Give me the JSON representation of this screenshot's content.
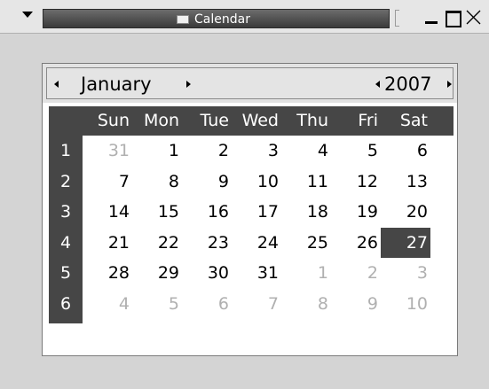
{
  "window": {
    "title": "Calendar"
  },
  "calendar": {
    "month": "January",
    "year": "2007",
    "weekdays": [
      "Sun",
      "Mon",
      "Tue",
      "Wed",
      "Thu",
      "Fri",
      "Sat"
    ],
    "weeks": [
      {
        "num": "1",
        "days": [
          {
            "d": "31",
            "other": true
          },
          {
            "d": "1"
          },
          {
            "d": "2"
          },
          {
            "d": "3"
          },
          {
            "d": "4"
          },
          {
            "d": "5"
          },
          {
            "d": "6"
          }
        ]
      },
      {
        "num": "2",
        "days": [
          {
            "d": "7"
          },
          {
            "d": "8"
          },
          {
            "d": "9"
          },
          {
            "d": "10"
          },
          {
            "d": "11"
          },
          {
            "d": "12"
          },
          {
            "d": "13"
          }
        ]
      },
      {
        "num": "3",
        "days": [
          {
            "d": "14"
          },
          {
            "d": "15"
          },
          {
            "d": "16"
          },
          {
            "d": "17"
          },
          {
            "d": "18"
          },
          {
            "d": "19"
          },
          {
            "d": "20"
          }
        ]
      },
      {
        "num": "4",
        "days": [
          {
            "d": "21"
          },
          {
            "d": "22"
          },
          {
            "d": "23"
          },
          {
            "d": "24"
          },
          {
            "d": "25"
          },
          {
            "d": "26"
          },
          {
            "d": "27",
            "selected": true
          }
        ]
      },
      {
        "num": "5",
        "days": [
          {
            "d": "28"
          },
          {
            "d": "29"
          },
          {
            "d": "30"
          },
          {
            "d": "31"
          },
          {
            "d": "1",
            "other": true
          },
          {
            "d": "2",
            "other": true
          },
          {
            "d": "3",
            "other": true
          }
        ]
      },
      {
        "num": "6",
        "days": [
          {
            "d": "4",
            "other": true
          },
          {
            "d": "5",
            "other": true
          },
          {
            "d": "6",
            "other": true
          },
          {
            "d": "7",
            "other": true
          },
          {
            "d": "8",
            "other": true
          },
          {
            "d": "9",
            "other": true
          },
          {
            "d": "10",
            "other": true
          }
        ]
      }
    ]
  },
  "colors": {
    "header_dark": "#464646",
    "selected_bg": "#464646",
    "other_month_text": "#b0b0b0",
    "window_bg": "#d4d4d4"
  },
  "icons": {
    "menu": "triangle-down-icon",
    "window_icon": "window-icon",
    "minimize": "minimize-icon",
    "maximize": "maximize-icon",
    "close": "close-icon",
    "prev": "arrow-left-icon",
    "next": "arrow-right-icon"
  }
}
